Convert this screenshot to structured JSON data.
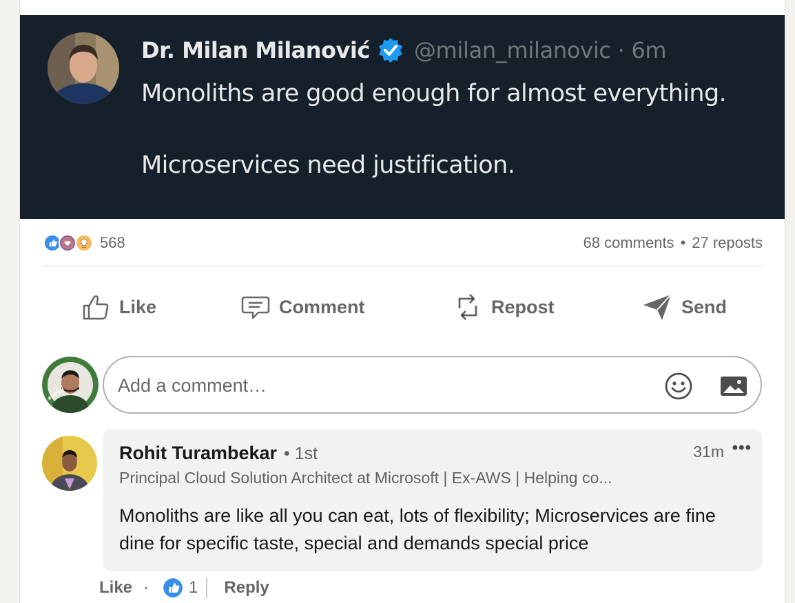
{
  "tweet": {
    "author_name": "Dr. Milan Milanović",
    "handle_time": "@milan_milanovic · 6m",
    "line1": "Monoliths are good enough for almost everything.",
    "line2": "Microservices need justification."
  },
  "social": {
    "reaction_count": "568",
    "comments": "68 comments",
    "reposts": "27 reposts",
    "reaction_icons": [
      "like-reaction-icon",
      "love-reaction-icon",
      "insightful-reaction-icon"
    ]
  },
  "actions": {
    "like": "Like",
    "comment": "Comment",
    "repost": "Repost",
    "send": "Send"
  },
  "comment_box": {
    "placeholder": "Add a comment…"
  },
  "comment": {
    "author": "Rohit Turambekar",
    "degree": "• 1st",
    "time": "31m",
    "more": "•••",
    "headline": "Principal Cloud Solution Architect at Microsoft | Ex-AWS | Helping co...",
    "text": "Monoliths are like all you can eat, lots of flexibility; Microservices are fine dine for specific taste, special and demands special price",
    "like_label": "Like",
    "sep": "·",
    "like_count": "1",
    "reply_label": "Reply"
  },
  "colors": {
    "tweet_bg": "#15202b",
    "verified_blue": "#1d9bf0",
    "like_blue": "#378fe9"
  }
}
